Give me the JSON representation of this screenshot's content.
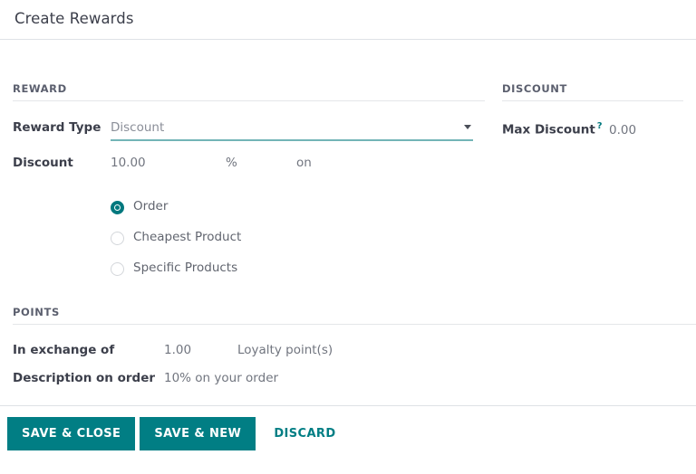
{
  "dialog": {
    "title": "Create Rewards"
  },
  "sections": {
    "reward": {
      "title": "REWARD",
      "reward_type": {
        "label": "Reward Type",
        "value": "Discount",
        "caret_icon": "chevron-down-icon"
      },
      "discount": {
        "label": "Discount",
        "amount": "10.00",
        "unit": "%",
        "applies_to_word": "on"
      },
      "applies_to_options": [
        {
          "label": "Order",
          "selected": true
        },
        {
          "label": "Cheapest Product",
          "selected": false
        },
        {
          "label": "Specific Products",
          "selected": false
        }
      ]
    },
    "discount": {
      "title": "DISCOUNT",
      "max_discount": {
        "label": "Max Discount",
        "help_icon": "?",
        "value": "0.00"
      }
    },
    "points": {
      "title": "POINTS",
      "in_exchange_of": {
        "label": "In exchange of",
        "value": "1.00",
        "unit": "Loyalty point(s)"
      },
      "description_on_order": {
        "label": "Description on order",
        "value": "10% on your order"
      }
    }
  },
  "footer": {
    "save_close_label": "SAVE & CLOSE",
    "save_new_label": "SAVE & NEW",
    "discard_label": "DISCARD"
  },
  "colors": {
    "accent": "#017e84",
    "underline": "#73b5b7",
    "label": "#3c3f4b",
    "value": "#71757f"
  }
}
